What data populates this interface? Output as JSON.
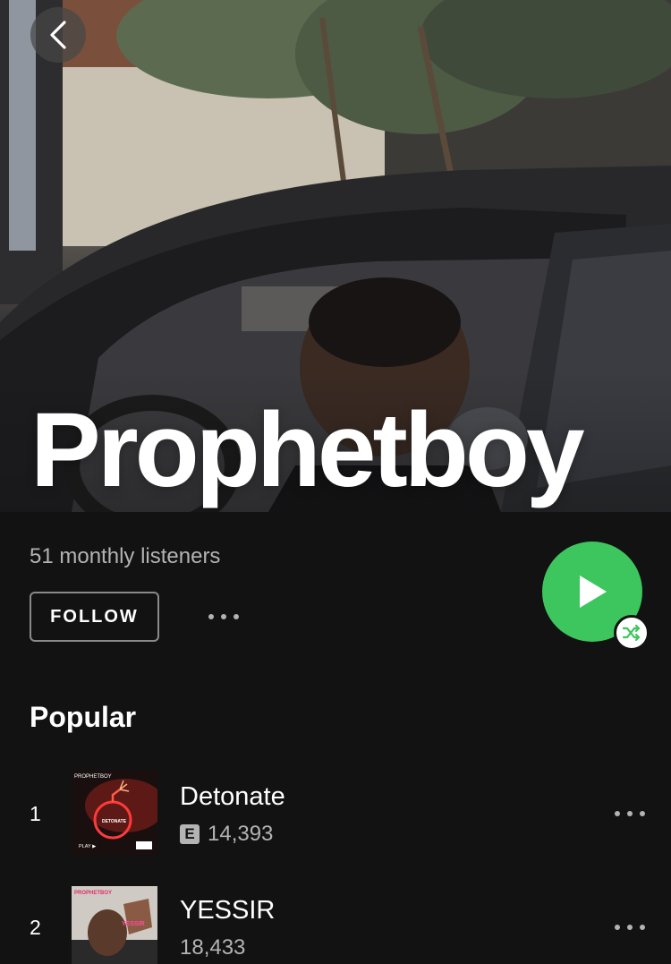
{
  "artist": {
    "name": "Prophetboy",
    "monthly_listeners": "51 monthly listeners"
  },
  "actions": {
    "follow_label": "FOLLOW",
    "more_icon": "more-horizontal-icon",
    "play_icon": "play-icon",
    "shuffle_icon": "shuffle-icon",
    "back_icon": "chevron-left-icon",
    "accent_color": "#3ec65e"
  },
  "popular": {
    "title": "Popular",
    "tracks": [
      {
        "rank": "1",
        "title": "Detonate",
        "explicit": "E",
        "plays": "14,393",
        "cover_text_top": "PROPHETBOY",
        "cover_text_mid": "DETONATE",
        "cover_text_play": "PLAY ▶"
      },
      {
        "rank": "2",
        "title": "YESSIR",
        "plays": "18,433",
        "cover_text_top": "PROPHETBOY",
        "cover_text_mid": "YESSIR"
      }
    ]
  }
}
